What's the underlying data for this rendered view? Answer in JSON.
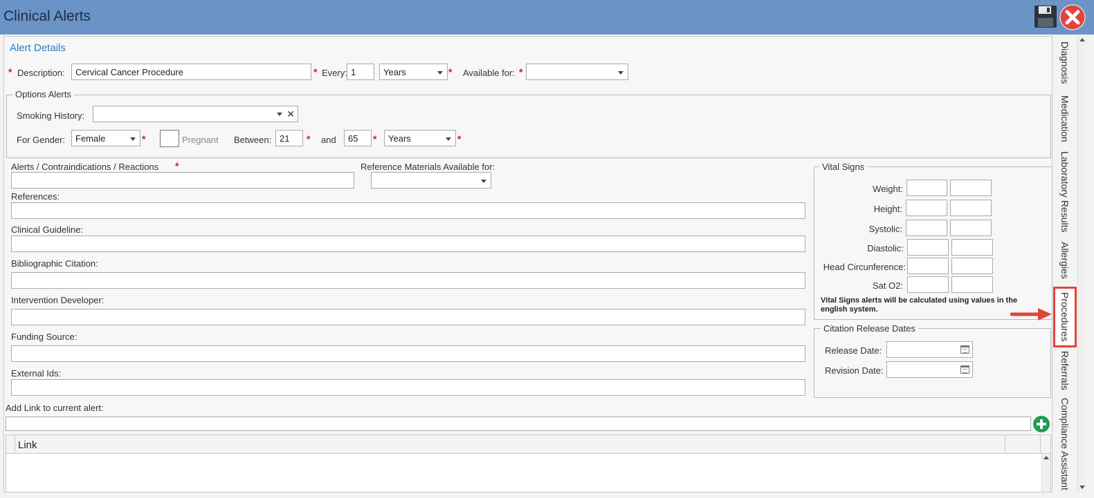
{
  "window": {
    "title": "Clinical Alerts"
  },
  "alert_details": {
    "section_title": "Alert Details",
    "description_label": "Description:",
    "description_value": "Cervical Cancer Procedure",
    "every_label": "Every:",
    "every_value": "1",
    "period_value": "Years",
    "available_label": "Available for:",
    "available_value": ""
  },
  "options_alerts": {
    "legend": "Options Alerts",
    "smoking_label": "Smoking History:",
    "smoking_value": "",
    "gender_label": "For Gender:",
    "gender_value": "Female",
    "pregnant_label": "Pregnant",
    "between_label": "Between:",
    "between_min": "21",
    "and_label": "and",
    "between_max": "65",
    "age_unit": "Years"
  },
  "fields": {
    "contra_label": "Alerts / Contraindications / Reactions",
    "refmat_label": "Reference Materials Available for:",
    "references_label": "References:",
    "guideline_label": "Clinical Guideline:",
    "biblio_label": "Bibliographic Citation:",
    "developer_label": "Intervention Developer:",
    "funding_label": "Funding Source:",
    "external_label": "External Ids:",
    "link_label": "Add Link to current alert:"
  },
  "vital_signs": {
    "legend": "Vital Signs",
    "rows": [
      "Weight:",
      "Height:",
      "Systolic:",
      "Diastolic:",
      "Head Circunference:",
      "Sat O2:"
    ],
    "note": "Vital Signs alerts will be calculated using values in the english system."
  },
  "citation": {
    "legend": "Citation Release Dates",
    "release_label": "Release Date:",
    "revision_label": "Revision Date:"
  },
  "link_table": {
    "column": "Link"
  },
  "side_tabs": [
    "Diagnosis",
    "Medication",
    "Laboratory Results",
    "Allergies",
    "Procedures",
    "Referrals",
    "Compliance Assistant"
  ],
  "active_tab": "Procedures",
  "colors": {
    "titlebar": "#6b93c6",
    "accent": "#2a7ec6",
    "required": "#d21a1a",
    "highlight": "#e0453c",
    "add_button": "#1f9d55"
  }
}
